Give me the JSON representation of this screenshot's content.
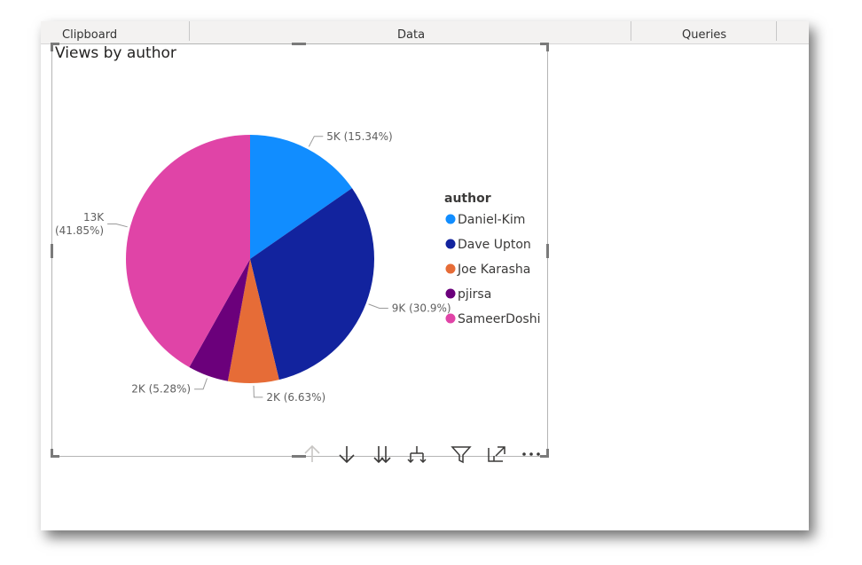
{
  "ribbon": {
    "groups": [
      "Clipboard",
      "Data",
      "Queries"
    ]
  },
  "visual": {
    "title": "Views by author",
    "toolbar_icons": [
      "arrow-up-icon",
      "arrow-down-icon",
      "double-arrow-down-icon",
      "expand-hierarchy-icon",
      "filter-icon",
      "focus-mode-icon",
      "more-options-icon"
    ]
  },
  "chart_data": {
    "type": "pie",
    "title": "Views by author",
    "legend_title": "author",
    "legend_position": "right",
    "slices": [
      {
        "label": "Daniel-Kim",
        "value": 5,
        "percent": 15.34,
        "data_label": "5K (15.34%)",
        "color": "#118DFF"
      },
      {
        "label": "Dave Upton",
        "value": 9,
        "percent": 30.9,
        "data_label": "9K (30.9%)",
        "color": "#12239E"
      },
      {
        "label": "Joe Karasha",
        "value": 2,
        "percent": 6.63,
        "data_label": "2K (6.63%)",
        "color": "#E66C37"
      },
      {
        "label": "pjirsa",
        "value": 2,
        "percent": 5.28,
        "data_label": "2K (5.28%)",
        "color": "#6B007B"
      },
      {
        "label": "SameerDoshi",
        "value": 13,
        "percent": 41.85,
        "data_label_lines": [
          "13K",
          "(41.85%)"
        ],
        "color": "#E044A7"
      }
    ]
  }
}
